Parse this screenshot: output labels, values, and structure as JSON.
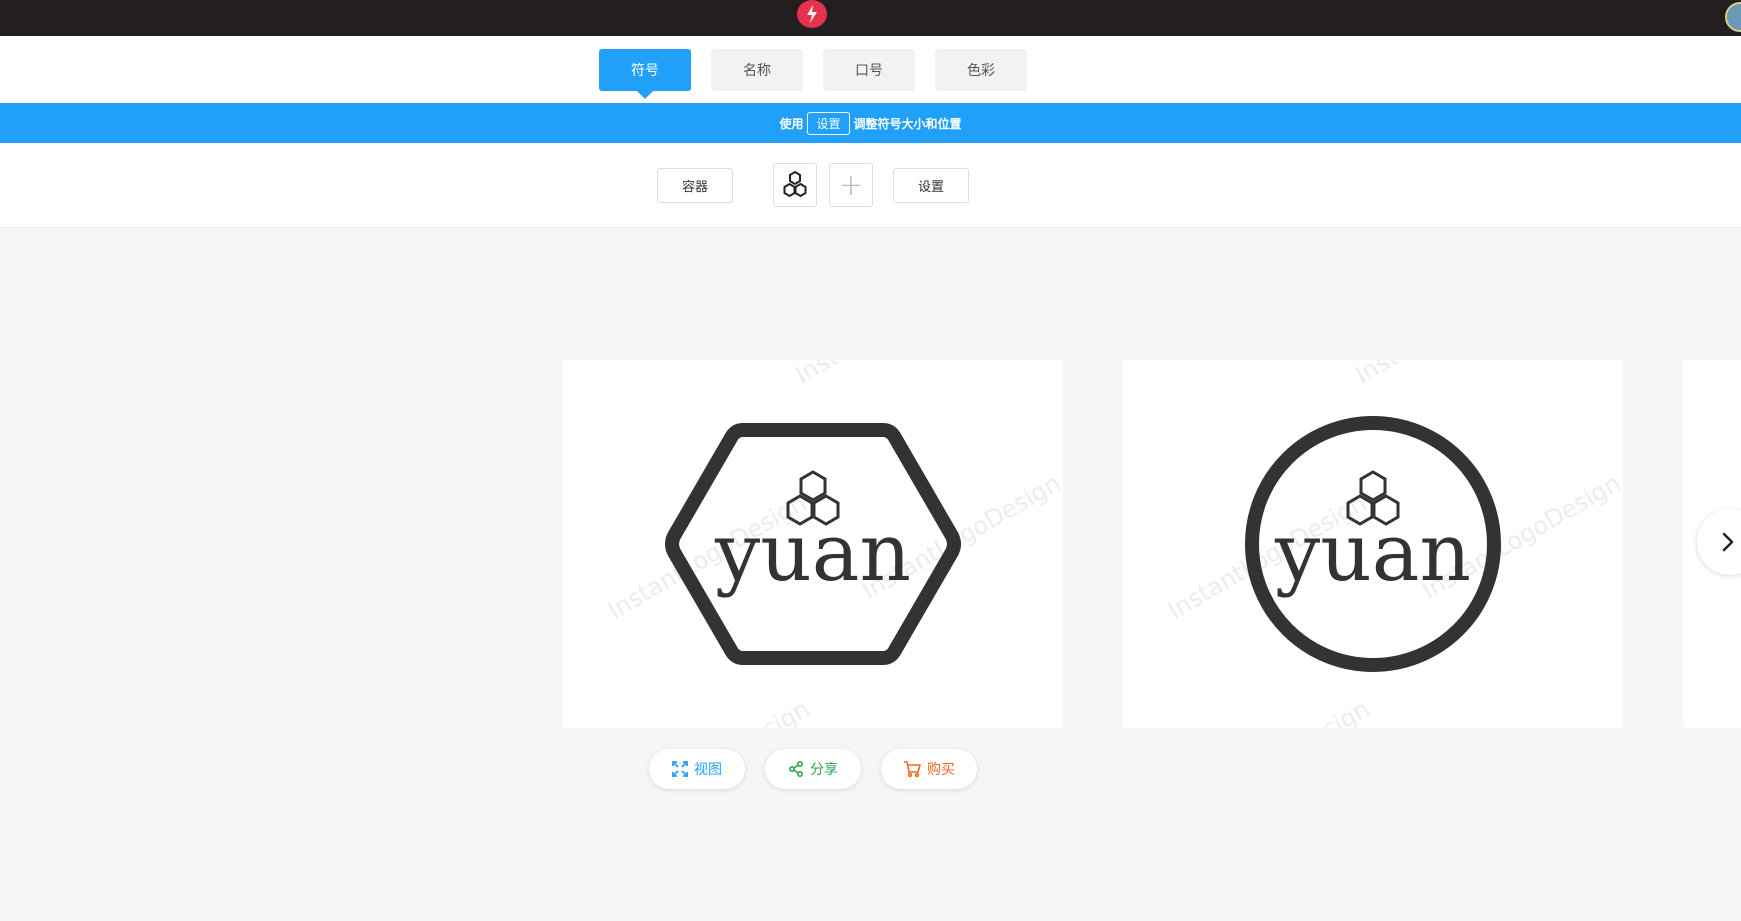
{
  "tabs": [
    {
      "label": "符号",
      "active": true
    },
    {
      "label": "名称",
      "active": false
    },
    {
      "label": "口号",
      "active": false
    },
    {
      "label": "色彩",
      "active": false
    }
  ],
  "hint": {
    "prefix": "使用",
    "button": "设置",
    "suffix": "调整符号大小和位置"
  },
  "toolbar": {
    "container_label": "容器",
    "settings_label": "设置",
    "add_glyph": "+"
  },
  "logo_text": "yuan",
  "watermark": "InstantLogoDesign",
  "actions": {
    "view": "视图",
    "share": "分享",
    "buy": "购买"
  },
  "colors": {
    "accent": "#21a0f9",
    "brand_red": "#e8314d",
    "logo_dark": "#333333",
    "share_green": "#2aa84a",
    "buy_orange": "#f06a1d"
  },
  "icons": [
    "lightning-icon",
    "honeycomb-icon",
    "plus-icon",
    "expand-icon",
    "share-icon",
    "cart-icon",
    "chevron-right-icon"
  ]
}
